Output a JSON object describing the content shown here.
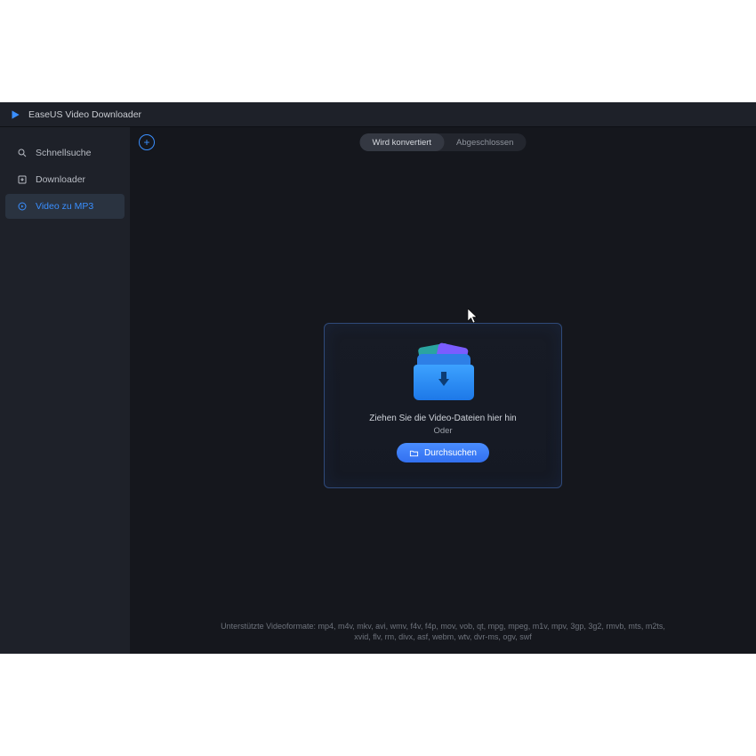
{
  "app": {
    "title": "EaseUS Video Downloader"
  },
  "sidebar": {
    "items": [
      {
        "label": "Schnellsuche"
      },
      {
        "label": "Downloader"
      },
      {
        "label": "Video zu MP3"
      }
    ]
  },
  "tabs": {
    "converting": "Wird konvertiert",
    "completed": "Abgeschlossen"
  },
  "dropzone": {
    "line1": "Ziehen Sie die Video-Dateien hier hin",
    "or": "Oder",
    "browse": "Durchsuchen"
  },
  "footer": {
    "line1": "Unterstützte Videoformate: mp4, m4v, mkv, avi, wmv, f4v, f4p, mov, vob, qt, mpg, mpeg, m1v, mpv, 3gp, 3g2, rmvb, mts, m2ts,",
    "line2": "xvid, flv, rm, divx, asf, webm, wtv, dvr-ms, ogv, swf"
  }
}
